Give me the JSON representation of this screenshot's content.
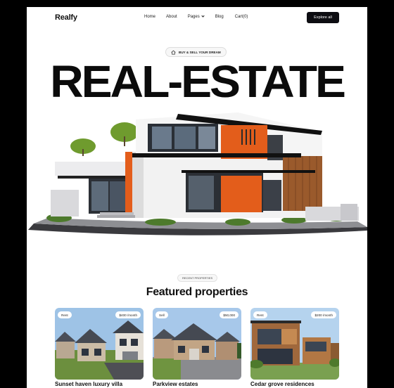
{
  "nav": {
    "brand": "Realfy",
    "items": [
      "Home",
      "About",
      "Pages",
      "Blog",
      "Cart(0)"
    ],
    "cta": "Explore all"
  },
  "hero": {
    "badge": "BUY & SELL YOUR DREAM",
    "title": "REAL-ESTATE"
  },
  "featured": {
    "badge": "RECENT PROPERTIES",
    "title": "Featured properties",
    "cards": [
      {
        "type": "Rent",
        "price": "$400 /month",
        "name": "Sunset haven luxury villa"
      },
      {
        "type": "Sell",
        "price": "$50,000",
        "name": "Parkview estates"
      },
      {
        "type": "Rent",
        "price": "$200 /month",
        "name": "Cedar grove residences"
      }
    ]
  },
  "colors": {
    "accent": "#e35d1b",
    "dark": "#0d0d12",
    "page": "#ffffff"
  },
  "icons": [
    "home-icon",
    "chevron-down-icon"
  ]
}
